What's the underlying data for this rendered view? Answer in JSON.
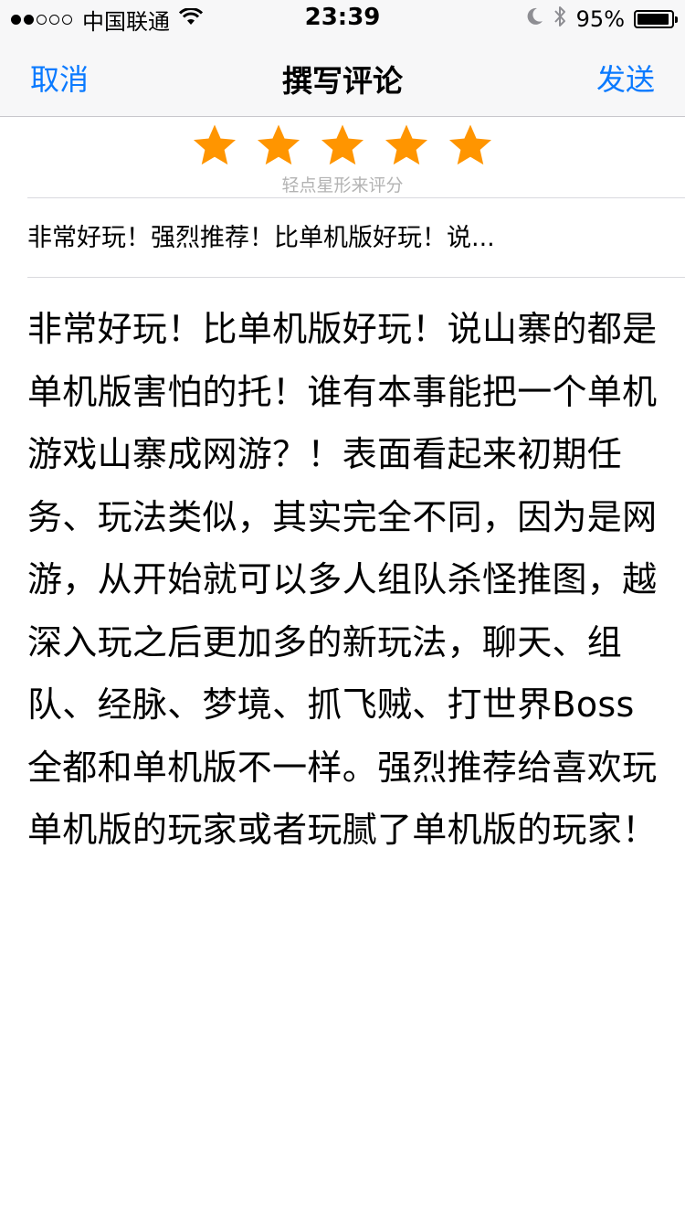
{
  "status_bar": {
    "carrier": "中国联通",
    "time": "23:39",
    "battery_percent": "95%",
    "battery_level": 0.95,
    "signal_strength": 2
  },
  "nav": {
    "cancel_label": "取消",
    "title": "撰写评论",
    "send_label": "发送"
  },
  "rating": {
    "value": 5,
    "max": 5,
    "star_color": "#ff9500",
    "hint": "轻点星形来评分"
  },
  "review": {
    "title": "非常好玩！强烈推荐！比单机版好玩！说...",
    "body": "非常好玩！比单机版好玩！说山寨的都是单机版害怕的托！谁有本事能把一个单机游戏山寨成网游？！表面看起来初期任务、玩法类似，其实完全不同，因为是网游，从开始就可以多人组队杀怪推图，越深入玩之后更加多的新玩法，聊天、组队、经脉、梦境、抓飞贼、打世界Boss全都和单机版不一样。强烈推荐给喜欢玩单机版的玩家或者玩腻了单机版的玩家！"
  },
  "colors": {
    "accent": "#0a7aff",
    "nav_background": "#f7f7f8"
  },
  "icons": [
    "signal-dots-icon",
    "wifi-icon",
    "moon-icon",
    "bluetooth-icon",
    "battery-icon",
    "star-icon"
  ]
}
